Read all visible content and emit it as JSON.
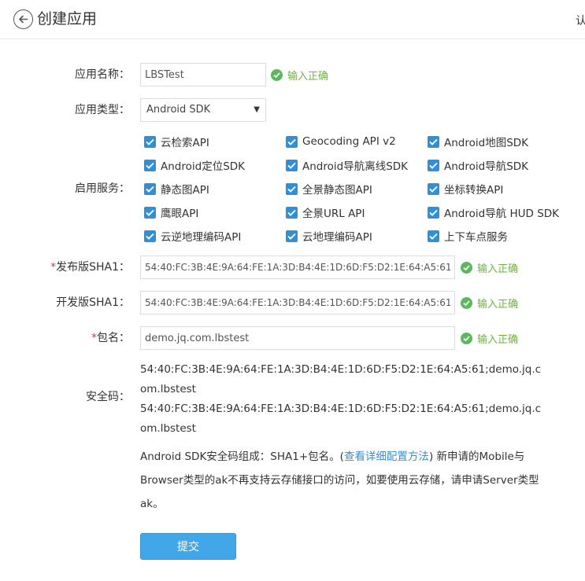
{
  "header": {
    "title": "创建应用",
    "right_text": "认"
  },
  "form": {
    "app_name": {
      "label": "应用名称：",
      "value": "LBSTest",
      "status": "输入正确"
    },
    "app_type": {
      "label": "应用类型：",
      "value": "Android SDK"
    },
    "services": {
      "label": "启用服务：",
      "items": [
        {
          "label": "云检索API",
          "checked": true
        },
        {
          "label": "Geocoding API v2",
          "checked": true
        },
        {
          "label": "Android地图SDK",
          "checked": true
        },
        {
          "label": "Android定位SDK",
          "checked": true
        },
        {
          "label": "Android导航离线SDK",
          "checked": true
        },
        {
          "label": "Android导航SDK",
          "checked": true
        },
        {
          "label": "静态图API",
          "checked": true
        },
        {
          "label": "全景静态图API",
          "checked": true
        },
        {
          "label": "坐标转换API",
          "checked": true
        },
        {
          "label": "鹰眼API",
          "checked": true
        },
        {
          "label": "全景URL API",
          "checked": true
        },
        {
          "label": "Android导航 HUD SDK",
          "checked": true
        },
        {
          "label": "云逆地理编码API",
          "checked": true
        },
        {
          "label": "云地理编码API",
          "checked": true
        },
        {
          "label": "上下车点服务",
          "checked": true
        }
      ]
    },
    "release_sha1": {
      "required_mark": "*",
      "label": "发布版SHA1：",
      "value": "54:40:FC:3B:4E:9A:64:FE:1A:3D:B4:4E:1D:6D:F5:D2:1E:64:A5:61",
      "status": "输入正确"
    },
    "dev_sha1": {
      "label": "开发版SHA1：",
      "value": "54:40:FC:3B:4E:9A:64:FE:1A:3D:B4:4E:1D:6D:F5:D2:1E:64:A5:61",
      "status": "输入正确"
    },
    "package": {
      "required_mark": "*",
      "label": "包名：",
      "value": "demo.jq.com.lbstest",
      "status": "输入正确"
    },
    "security_code": {
      "label": "安全码：",
      "lines": [
        "54:40:FC:3B:4E:9A:64:FE:1A:3D:B4:4E:1D:6D:F5:D2:1E:64:A5:61;demo.jq.com.lbstest",
        "54:40:FC:3B:4E:9A:64:FE:1A:3D:B4:4E:1D:6D:F5:D2:1E:64:A5:61;demo.jq.com.lbstest"
      ]
    },
    "note": {
      "prefix": "Android SDK安全码组成：SHA1+包名。(",
      "link": "查看详细配置方法",
      "suffix": ") 新申请的Mobile与Browser类型的ak不再支持云存储接口的访问，如要使用云存储，请申请Server类型ak。"
    },
    "submit_label": "提交"
  },
  "colors": {
    "accent": "#41a7e8",
    "checkbox": "#2f8fd8",
    "valid": "#6db33f",
    "link": "#3a8fd1",
    "required": "#e4393c"
  }
}
